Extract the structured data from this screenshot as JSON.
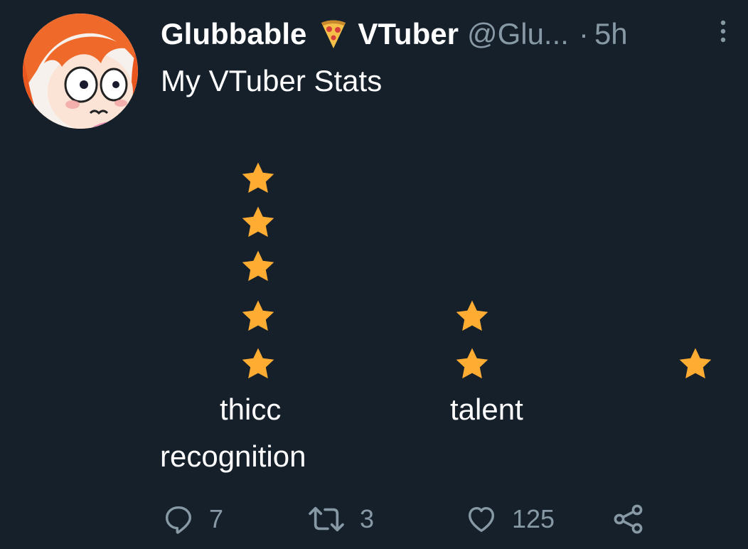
{
  "tweet": {
    "display_name_part1": "Glubbable",
    "display_name_part2": "VTuber",
    "name_emoji": "pizza",
    "handle": "@Glu...",
    "separator": "·",
    "time": "5h",
    "text": "My VTuber Stats"
  },
  "stats": [
    {
      "label": "thicc",
      "stars": 5
    },
    {
      "label": "talent",
      "stars": 2
    },
    {
      "label": "recognition",
      "stars": 1
    }
  ],
  "actions": {
    "replies": "7",
    "retweets": "3",
    "likes": "125"
  },
  "colors": {
    "background": "#15202b",
    "star": "#ffac33",
    "muted": "#8899a6",
    "text": "#ffffff"
  }
}
